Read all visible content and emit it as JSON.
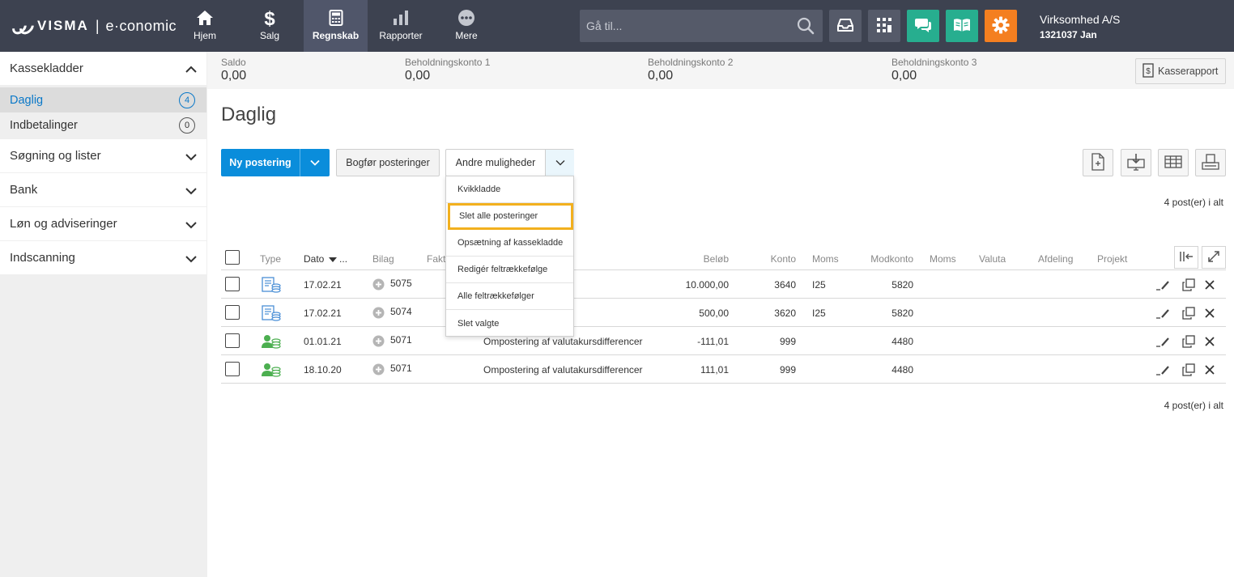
{
  "app": {
    "brand": "VISMA",
    "separator": "|",
    "product": "e·conomic"
  },
  "nav": {
    "hjem": "Hjem",
    "salg": "Salg",
    "regnskab": "Regnskab",
    "rapporter": "Rapporter",
    "mere": "Mere"
  },
  "search": {
    "placeholder": "Gå til..."
  },
  "company": {
    "name": "Virksomhed A/S",
    "id": "1321037 Jan"
  },
  "sidebar": {
    "kassekladder": "Kassekladder",
    "daglig": {
      "label": "Daglig",
      "count": "4"
    },
    "indbetalinger": {
      "label": "Indbetalinger",
      "count": "0"
    },
    "sogning": "Søgning og lister",
    "bank": "Bank",
    "lon": "Løn og adviseringer",
    "indscanning": "Indscanning"
  },
  "summary": {
    "saldo": {
      "label": "Saldo",
      "value": "0,00"
    },
    "konto1": {
      "label": "Beholdningskonto 1",
      "value": "0,00"
    },
    "konto2": {
      "label": "Beholdningskonto 2",
      "value": "0,00"
    },
    "konto3": {
      "label": "Beholdningskonto 3",
      "value": "0,00"
    },
    "kasserapport": "Kasserapport"
  },
  "page": {
    "title": "Daglig"
  },
  "actions": {
    "ny_postering": "Ny postering",
    "bogfor": "Bogfør posteringer",
    "andre": "Andre muligheder"
  },
  "dropdown": [
    "Kvikkladde",
    "Slet alle posteringer",
    "Opsætning af kassekladde",
    "Redigér feltrækkefølge",
    "Alle feltrækkefølger",
    "Slet valgte"
  ],
  "count_text": "4 post(er) i alt",
  "table": {
    "headers": {
      "type": "Type",
      "dato": "Dato",
      "dato_more": "...",
      "bilag": "Bilag",
      "faktura": "Fakt",
      "belob": "Beløb",
      "konto": "Konto",
      "moms": "Moms",
      "modkonto": "Modkonto",
      "moms2": "Moms",
      "valuta": "Valuta",
      "afdeling": "Afdeling",
      "projekt": "Projekt"
    },
    "rows": [
      {
        "type": "finance",
        "dato": "17.02.21",
        "bilag": "5075",
        "tekst": "",
        "belob": "10.000,00",
        "konto": "3640",
        "moms": "I25",
        "modkonto": "5820"
      },
      {
        "type": "finance",
        "dato": "17.02.21",
        "bilag": "5074",
        "tekst": "",
        "belob": "500,00",
        "konto": "3620",
        "moms": "I25",
        "modkonto": "5820"
      },
      {
        "type": "person",
        "dato": "01.01.21",
        "bilag": "5071",
        "tekst": "Ompostering af valutakursdifferencer",
        "belob": "-111,01",
        "konto": "999",
        "moms": "",
        "modkonto": "4480"
      },
      {
        "type": "person",
        "dato": "18.10.20",
        "bilag": "5071",
        "tekst": "Ompostering af valutakursdifferencer",
        "belob": "111,01",
        "konto": "999",
        "moms": "",
        "modkonto": "4480"
      }
    ]
  },
  "icons": {
    "home": "home-icon",
    "dollar": "dollar-icon",
    "calculator": "calculator-icon",
    "bar_chart": "bar-chart-icon",
    "more": "more-icon",
    "search": "search-icon",
    "inbox": "inbox-icon",
    "apps": "apps-icon",
    "chat": "chat-icon",
    "book": "book-icon",
    "gear": "gear-icon"
  },
  "colors": {
    "topbar": "#3d4250",
    "primary": "#0a8ddb",
    "teal": "#27ae8f",
    "orange": "#f47f20",
    "highlight": "#f2b01e",
    "active_link": "#0a78c8"
  }
}
